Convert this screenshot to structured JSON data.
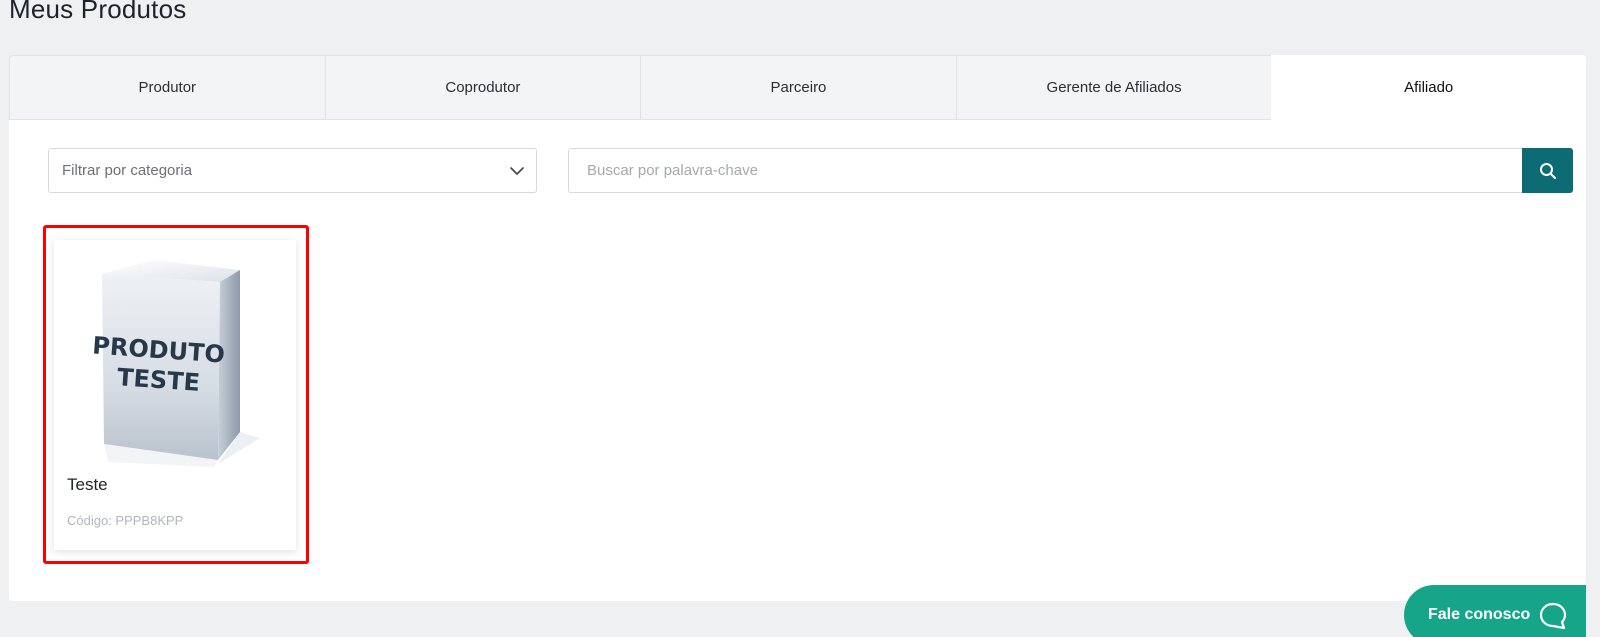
{
  "page": {
    "title": "Meus Produtos"
  },
  "tabs": [
    {
      "label": "Produtor",
      "active": false
    },
    {
      "label": "Coprodutor",
      "active": false
    },
    {
      "label": "Parceiro",
      "active": false
    },
    {
      "label": "Gerente de Afiliados",
      "active": false
    },
    {
      "label": "Afiliado",
      "active": true
    }
  ],
  "filter": {
    "placeholder": "Filtrar por categoria",
    "icon": "chevron-down-icon"
  },
  "search": {
    "placeholder": "Buscar por palavra-chave",
    "icon": "search-icon",
    "button_color": "#0c6b73"
  },
  "products": [
    {
      "image_text_line1": "PRODUTO",
      "image_text_line2": "TESTE",
      "name": "Teste",
      "code": "Código: PPPB8KPP"
    }
  ],
  "contact": {
    "label": "Fale conosco",
    "icon": "chat-bubble-icon",
    "color": "#17a589"
  },
  "highlight": {
    "color": "#ff0000"
  }
}
